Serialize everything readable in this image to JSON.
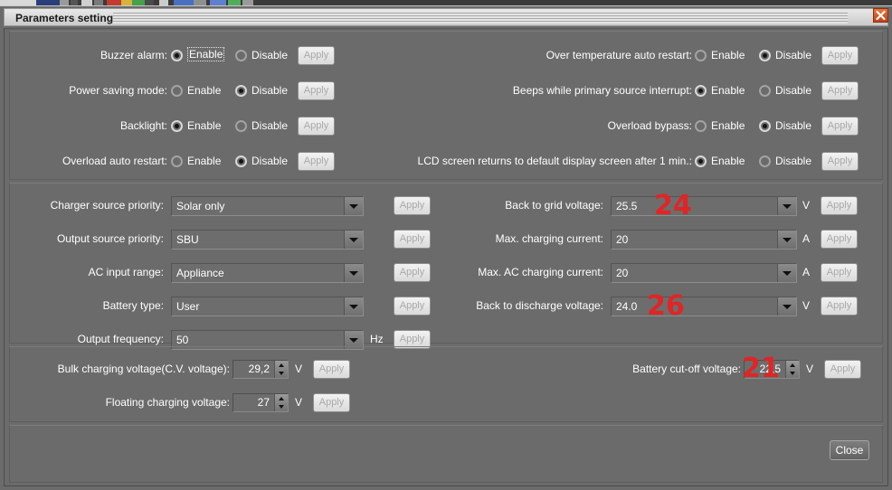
{
  "window": {
    "title": "Parameters setting",
    "close_icon": "close-x-icon",
    "close_button_label": "Close"
  },
  "common": {
    "enable_label": "Enable",
    "disable_label": "Disable",
    "apply_label": "Apply",
    "dropdown_icon": "chevron-down-icon",
    "spinner_up_icon": "caret-up-icon",
    "spinner_down_icon": "caret-down-icon"
  },
  "colors": {
    "annotation_red": "#e02525",
    "window_background": "#6b6b6b",
    "close_button_red": "#c4401c"
  },
  "radio_section": {
    "left_rows": [
      {
        "label": "Buzzer alarm:",
        "selected": "enable",
        "focused": true
      },
      {
        "label": "Power saving mode:",
        "selected": "disable",
        "focused": false
      },
      {
        "label": "Backlight:",
        "selected": "enable",
        "focused": false
      },
      {
        "label": "Overload auto restart:",
        "selected": "disable",
        "focused": false
      }
    ],
    "right_rows": [
      {
        "label": "Over temperature auto restart:",
        "selected": "disable"
      },
      {
        "label": "Beeps while primary source interrupt:",
        "selected": "enable"
      },
      {
        "label": "Overload bypass:",
        "selected": "disable"
      },
      {
        "label": "LCD screen returns to default display screen after 1 min.:",
        "selected": "enable"
      }
    ]
  },
  "select_section": {
    "left_rows": [
      {
        "label": "Charger source priority:",
        "value": "Solar only",
        "unit": ""
      },
      {
        "label": "Output source priority:",
        "value": "SBU",
        "unit": ""
      },
      {
        "label": "AC input range:",
        "value": "Appliance",
        "unit": ""
      },
      {
        "label": "Battery type:",
        "value": "User",
        "unit": ""
      },
      {
        "label": "Output frequency:",
        "value": "50",
        "unit": "Hz"
      }
    ],
    "right_rows": [
      {
        "label": "Back to grid voltage:",
        "value": "25.5",
        "unit": "V",
        "annotation": "24"
      },
      {
        "label": "Max. charging current:",
        "value": "20",
        "unit": "A",
        "annotation": ""
      },
      {
        "label": "Max. AC charging current:",
        "value": "20",
        "unit": "A",
        "annotation": ""
      },
      {
        "label": "Back to discharge voltage:",
        "value": "24.0",
        "unit": "V",
        "annotation": "26"
      }
    ]
  },
  "spin_section": {
    "left_rows": [
      {
        "label": "Bulk charging voltage(C.V. voltage):",
        "value": "29,2",
        "unit": "V"
      },
      {
        "label": "Floating charging voltage:",
        "value": "27",
        "unit": "V"
      }
    ],
    "right_rows": [
      {
        "label": "Battery cut-off voltage:",
        "value": "22,5",
        "unit": "V",
        "annotation": "21"
      }
    ]
  }
}
